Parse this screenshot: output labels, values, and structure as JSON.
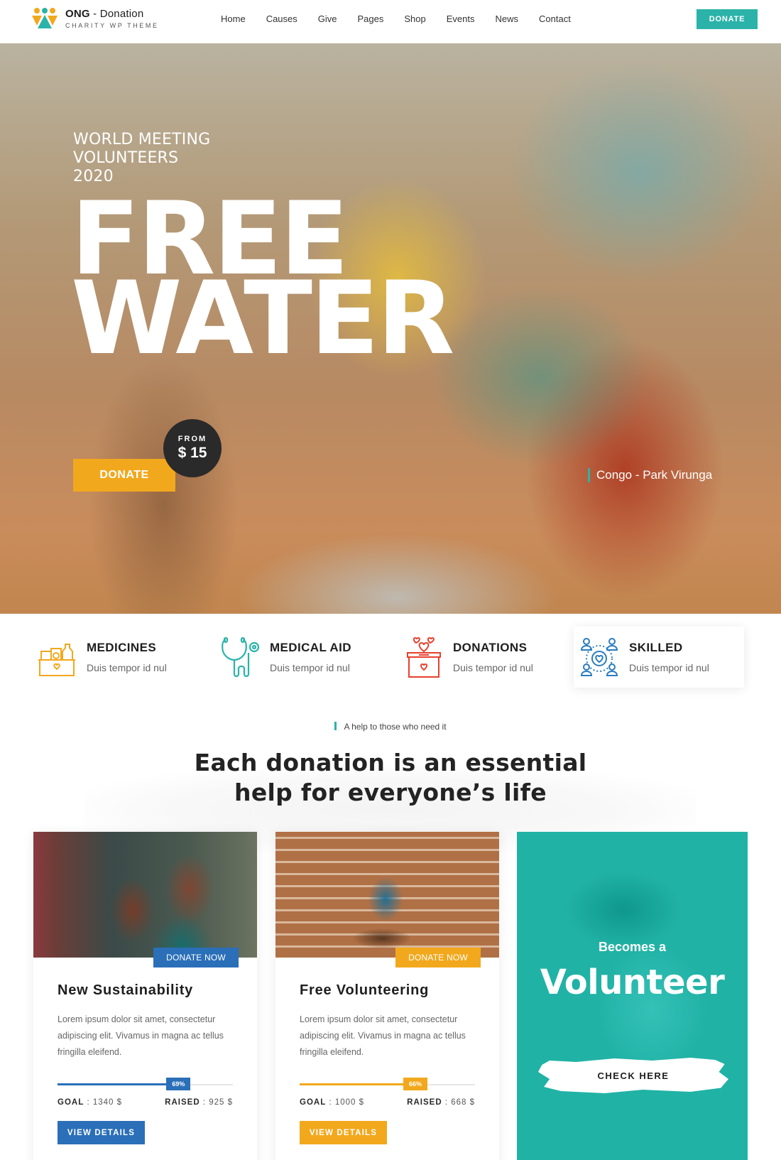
{
  "header": {
    "logo_title_bold": "ONG",
    "logo_title_rest": " - Donation",
    "logo_subtitle": "CHARITY WP THEME",
    "nav": [
      "Home",
      "Causes",
      "Give",
      "Pages",
      "Shop",
      "Events",
      "News",
      "Contact"
    ],
    "donate_label": "DONATE",
    "accent_color": "#2bb3a9"
  },
  "hero": {
    "subtitle_lines": [
      "WORLD MEETING",
      "VOLUNTEERS",
      "2020"
    ],
    "title_lines": [
      "FREE",
      "WATER"
    ],
    "donate_label": "DONATE",
    "price_from": "FROM",
    "price_value": "$ 15",
    "location": "Congo - Park Virunga",
    "donate_color": "#f2a81d"
  },
  "features": [
    {
      "icon": "medicine-box-icon",
      "title": "MEDICINES",
      "desc": "Duis tempor id nul",
      "color": "#f2a81d"
    },
    {
      "icon": "stethoscope-icon",
      "title": "MEDICAL AID",
      "desc": "Duis tempor id nul",
      "color": "#2bb3a9"
    },
    {
      "icon": "donation-box-icon",
      "title": "DONATIONS",
      "desc": "Duis tempor id nul",
      "color": "#e8402e"
    },
    {
      "icon": "people-network-icon",
      "title": "SKILLED",
      "desc": "Duis tempor id nul",
      "color": "#2a7cc0"
    }
  ],
  "section": {
    "eyebrow": "A help to those who need it",
    "title_lines": [
      "Each donation is an essential",
      "help for everyone’s life"
    ]
  },
  "causes": [
    {
      "donate_now": "DONATE NOW",
      "title": "New Sustainability",
      "text": "Lorem ipsum dolor sit amet, consectetur adipiscing elit. Vivamus in magna ac tellus fringilla eleifend.",
      "progress_percent": 69,
      "progress_label": "69%",
      "goal_label": "GOAL",
      "goal_value": ": 1340 $",
      "raised_label": "RAISED",
      "raised_value": ": 925 $",
      "button": "VIEW DETAILS",
      "color": "#2a6fb8"
    },
    {
      "donate_now": "DONATE NOW",
      "title": "Free Volunteering",
      "text": "Lorem ipsum dolor sit amet, consectetur adipiscing elit. Vivamus in magna ac tellus fringilla eleifend.",
      "progress_percent": 66,
      "progress_label": "66%",
      "goal_label": "GOAL",
      "goal_value": ": 1000 $",
      "raised_label": "RAISED",
      "raised_value": ": 668 $",
      "button": "VIEW DETAILS",
      "color": "#f2a81d"
    }
  ],
  "volunteer": {
    "small": "Becomes a",
    "big": "Volunteer",
    "button": "CHECK HERE"
  }
}
